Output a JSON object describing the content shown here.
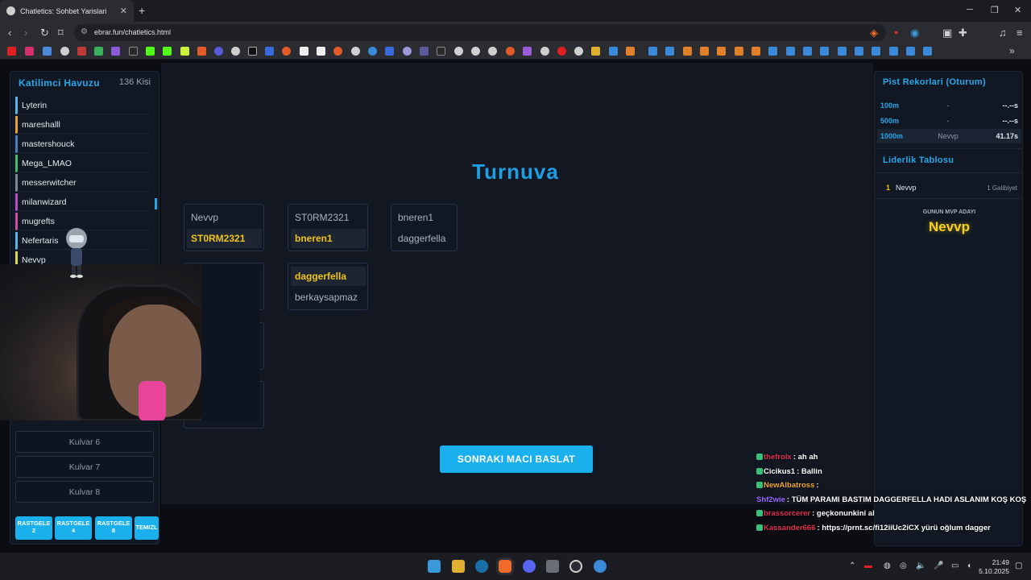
{
  "browser": {
    "tab_title": "Chatletics: Sohbet Yarislari",
    "url": "ebrar.fun/chatletics.html"
  },
  "participants": {
    "title": "Katilimci Havuzu",
    "count": "136 Kisi",
    "names": [
      {
        "name": "Lyterin",
        "color": "#5ab4e6"
      },
      {
        "name": "mareshalll",
        "color": "#e0a33a"
      },
      {
        "name": "mastershouck",
        "color": "#4f7fbf"
      },
      {
        "name": "Mega_LMAO",
        "color": "#3fbf6a"
      },
      {
        "name": "messerwitcher",
        "color": "#7a8a9a"
      },
      {
        "name": "milanwizard",
        "color": "#b44fc4"
      },
      {
        "name": "mugrefts",
        "color": "#c94fa0"
      },
      {
        "name": "Nefertaris",
        "color": "#5ab4e6"
      },
      {
        "name": "Nevvp",
        "color": "#d8d84a"
      }
    ]
  },
  "lanes": [
    "Kulvar 6",
    "Kulvar 7",
    "Kulvar 8"
  ],
  "random_buttons": [
    "RASTGELE 2",
    "RASTGELE 4",
    "RASTGELE 8",
    "TEMIZL"
  ],
  "tournament": {
    "title": "Turnuva",
    "matches": [
      {
        "p1": "Nevvp",
        "p2": "ST0RM2321",
        "winner": "p2"
      },
      {
        "p1": "ST0RM2321",
        "p2": "bneren1",
        "winner": "p2"
      },
      {
        "p1": "bneren1",
        "p2": "daggerfella",
        "winner": ""
      },
      {
        "p1": "daggerfella",
        "p2": "berkaysapmaz",
        "winner": "p1"
      }
    ],
    "start_button": "SONRAKI MACI BASLAT"
  },
  "records": {
    "title": "Pist Rekorlari (Oturum)",
    "rows": [
      {
        "distance": "100m",
        "name": "-",
        "time": "--.--s"
      },
      {
        "distance": "500m",
        "name": "-",
        "time": "--.--s"
      },
      {
        "distance": "1000m",
        "name": "Nevvp",
        "time": "41.17s"
      }
    ]
  },
  "leaderboard": {
    "title": "Liderlik Tablosu",
    "rank": "1",
    "name": "Nevvp",
    "wins": "1 Galibiyet"
  },
  "mvp": {
    "label": "GUNUN MVP ADAYI",
    "name": "Nevvp"
  },
  "chat": [
    {
      "user": "thefrolx",
      "color": "#e0304f",
      "msg": ": ah ah"
    },
    {
      "user": "Cicikus1",
      "color": "#ffffff",
      "msg": ": Ballin"
    },
    {
      "user": "NewAlbatross",
      "color": "#f0a830",
      "msg": ":"
    },
    {
      "user": "Shf2wie",
      "color": "#9b6bff",
      "msg": ": TÜM PARAMI BASTIM DAGGERFELLA HADI ASLANIM KOŞ KOŞ"
    },
    {
      "user": "brassorcerer",
      "color": "#e0304f",
      "msg": ": geçkonunkini al"
    },
    {
      "user": "Kassander666",
      "color": "#e0304f",
      "msg": ": https://prnt.sc/fi12iiUc2iCX yürü oğlum dagger"
    }
  ],
  "clock": {
    "time": "21:49",
    "date": "5.10.2025"
  }
}
